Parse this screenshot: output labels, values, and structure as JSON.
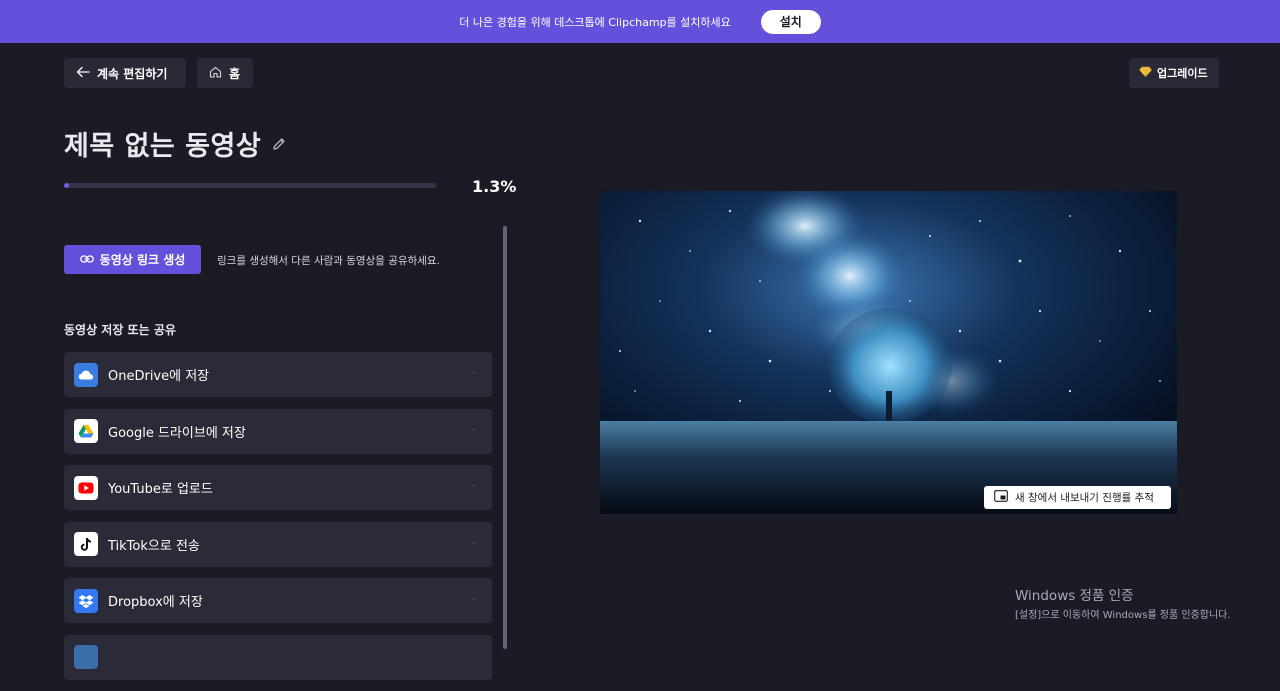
{
  "banner": {
    "text": "더 나은 경험을 위해 데스크톱에 Clipchamp를 설치하세요",
    "install_label": "설치"
  },
  "nav": {
    "back_label": "계속 편집하기",
    "home_label": "홈",
    "upgrade_label": "업그레이드"
  },
  "video": {
    "title": "제목 없는 동영상"
  },
  "progress": {
    "percent": 1.3,
    "percent_label": "1.3%"
  },
  "link": {
    "button_label": "동영상 링크 생성",
    "description": "링크를 생성해서 다른 사람과 동영상을 공유하세요."
  },
  "share": {
    "section_title": "동영상 저장 또는 공유",
    "items": [
      {
        "label": "OneDrive에 저장",
        "icon": "onedrive-icon",
        "color": "#3b7ce0"
      },
      {
        "label": "Google 드라이브에 저장",
        "icon": "google-drive-icon",
        "color": "#ffffff"
      },
      {
        "label": "YouTube로 업로드",
        "icon": "youtube-icon",
        "color": "#ffffff"
      },
      {
        "label": "TikTok으로 전송",
        "icon": "tiktok-icon",
        "color": "#ffffff"
      },
      {
        "label": "Dropbox에 저장",
        "icon": "dropbox-icon",
        "color": "#3478f6"
      }
    ]
  },
  "preview": {
    "track_label": "새 창에서 내보내기 진행률 추적"
  },
  "watermark": {
    "line1": "Windows 정품 인증",
    "line2": "[설정]으로 이동하여 Windows를 정품 인증합니다."
  },
  "colors": {
    "accent": "#6351dc",
    "background": "#1b1b26",
    "card": "#2a2a38"
  }
}
